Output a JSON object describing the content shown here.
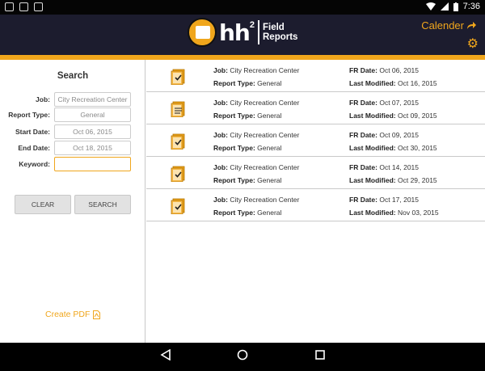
{
  "status_bar": {
    "time": "7:36"
  },
  "header": {
    "logo_main": "hh",
    "logo_sup": "2",
    "logo_line1": "Field",
    "logo_line2": "Reports",
    "calendar_label": "Calender",
    "settings_icon": "gear-icon",
    "accent": "#f0a61c"
  },
  "search": {
    "title": "Search",
    "fields": [
      {
        "label": "Job:",
        "value": "City Recreation Center"
      },
      {
        "label": "Report Type:",
        "value": "General"
      },
      {
        "label": "Start Date:",
        "value": "Oct 06, 2015"
      },
      {
        "label": "End Date:",
        "value": "Oct 18, 2015"
      },
      {
        "label": "Keyword:",
        "value": ""
      }
    ],
    "clear_label": "CLEAR",
    "search_label": "SEARCH",
    "pdf_label": "Create PDF"
  },
  "reports": [
    {
      "job": "City Recreation Center",
      "type": "General",
      "fr_date": "Oct 06, 2015",
      "modified": "Oct 16, 2015",
      "checked": true
    },
    {
      "job": "City Recreation Center",
      "type": "General",
      "fr_date": "Oct 07, 2015",
      "modified": "Oct 09, 2015",
      "checked": false
    },
    {
      "job": "City Recreation Center",
      "type": "General",
      "fr_date": "Oct 09, 2015",
      "modified": "Oct 30, 2015",
      "checked": true
    },
    {
      "job": "City Recreation Center",
      "type": "General",
      "fr_date": "Oct 14, 2015",
      "modified": "Oct 29, 2015",
      "checked": true
    },
    {
      "job": "City Recreation Center",
      "type": "General",
      "fr_date": "Oct 17, 2015",
      "modified": "Nov 03, 2015",
      "checked": true
    }
  ],
  "labels": {
    "job": "Job:",
    "report_type": "Report Type:",
    "fr_date": "FR Date:",
    "last_modified": "Last Modified:"
  }
}
